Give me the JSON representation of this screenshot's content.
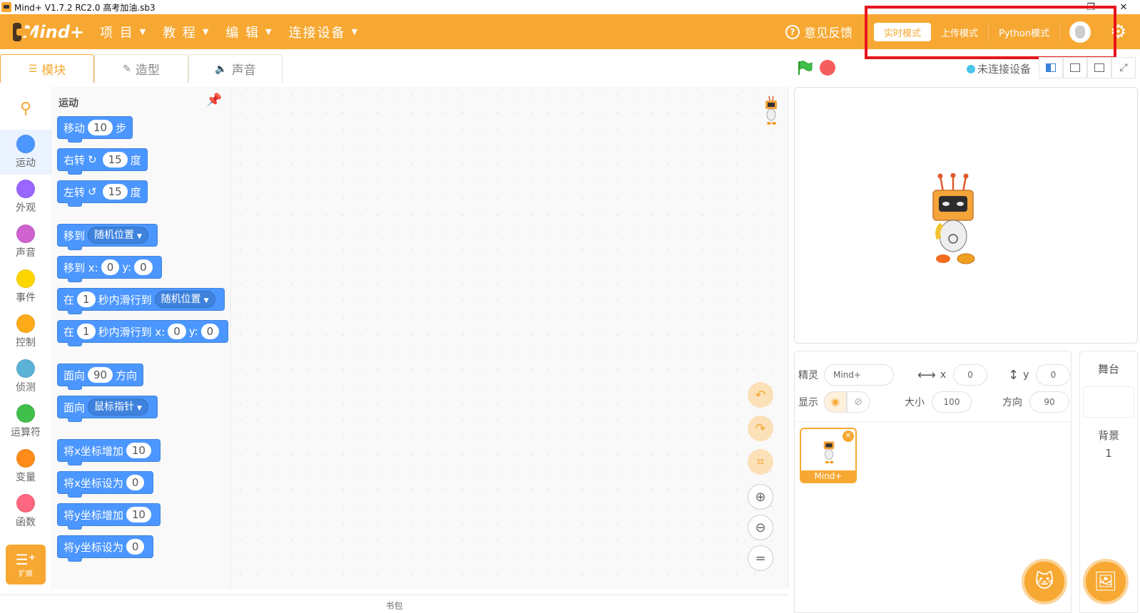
{
  "window": {
    "title": "Mind+ V1.7.2 RC2.0   高考加油.sb3",
    "minimize": "—",
    "restore": "❐",
    "close": "✕"
  },
  "menubar": {
    "logo": "Mind+",
    "items": [
      {
        "label": "项 目"
      },
      {
        "label": "教 程"
      },
      {
        "label": "编 辑"
      },
      {
        "label": "连接设备"
      }
    ],
    "feedback": "意见反馈",
    "modes": [
      {
        "label": "实时模式",
        "active": true
      },
      {
        "label": "上传模式",
        "active": false
      },
      {
        "label": "Python模式",
        "active": false
      }
    ]
  },
  "tabs": [
    {
      "label": "模块",
      "icon": "blocks-icon",
      "active": true
    },
    {
      "label": "造型",
      "icon": "brush-icon",
      "active": false
    },
    {
      "label": "声音",
      "icon": "speaker-icon",
      "active": false
    }
  ],
  "stage_controls": {
    "connection_status": "未连接设备"
  },
  "categories": [
    {
      "label": "运动",
      "color": "#4c97ff",
      "active": true
    },
    {
      "label": "外观",
      "color": "#9966ff",
      "active": false
    },
    {
      "label": "声音",
      "color": "#cf63cf",
      "active": false
    },
    {
      "label": "事件",
      "color": "#ffd500",
      "active": false
    },
    {
      "label": "控制",
      "color": "#ffab19",
      "active": false
    },
    {
      "label": "侦测",
      "color": "#5cb1d6",
      "active": false
    },
    {
      "label": "运算符",
      "color": "#40bf4a",
      "active": false
    },
    {
      "label": "变量",
      "color": "#ff8c1a",
      "active": false
    },
    {
      "label": "函数",
      "color": "#ff6680",
      "active": false
    }
  ],
  "extension": {
    "label": "扩展"
  },
  "palette": {
    "title": "运动",
    "blocks": {
      "move": {
        "a": "移动",
        "v": "10",
        "b": "步"
      },
      "turn_right": {
        "a": "右转",
        "v": "15",
        "b": "度"
      },
      "turn_left": {
        "a": "左转",
        "v": "15",
        "b": "度"
      },
      "goto": {
        "a": "移到",
        "d": "随机位置"
      },
      "goto_xy": {
        "a": "移到 x:",
        "x": "0",
        "b": "y:",
        "y": "0"
      },
      "glide_to": {
        "a": "在",
        "v": "1",
        "b": "秒内滑行到",
        "d": "随机位置"
      },
      "glide_xy": {
        "a": "在",
        "v": "1",
        "b": "秒内滑行到 x:",
        "x": "0",
        "c": "y:",
        "y": "0"
      },
      "point_dir": {
        "a": "面向",
        "v": "90",
        "b": "方向"
      },
      "point_towards": {
        "a": "面向",
        "d": "鼠标指针"
      },
      "change_x": {
        "a": "将x坐标增加",
        "v": "10"
      },
      "set_x": {
        "a": "将x坐标设为",
        "v": "0"
      },
      "change_y": {
        "a": "将y坐标增加",
        "v": "10"
      },
      "set_y": {
        "a": "将y坐标设为",
        "v": "0"
      }
    }
  },
  "backpack": "书包",
  "sprite_info": {
    "sprite_label": "精灵",
    "sprite_name": "Mind+",
    "x_label": "x",
    "x": "0",
    "y_label": "y",
    "y": "0",
    "show_label": "显示",
    "size_label": "大小",
    "size": "100",
    "direction_label": "方向",
    "direction": "90"
  },
  "sprites": [
    {
      "name": "Mind+"
    }
  ],
  "stage_panel": {
    "title": "舞台",
    "backdrop_label": "背景",
    "backdrop_count": "1"
  },
  "colors": {
    "accent": "#f7a832",
    "motion": "#4c97ff",
    "highlight": "#e8141b"
  }
}
